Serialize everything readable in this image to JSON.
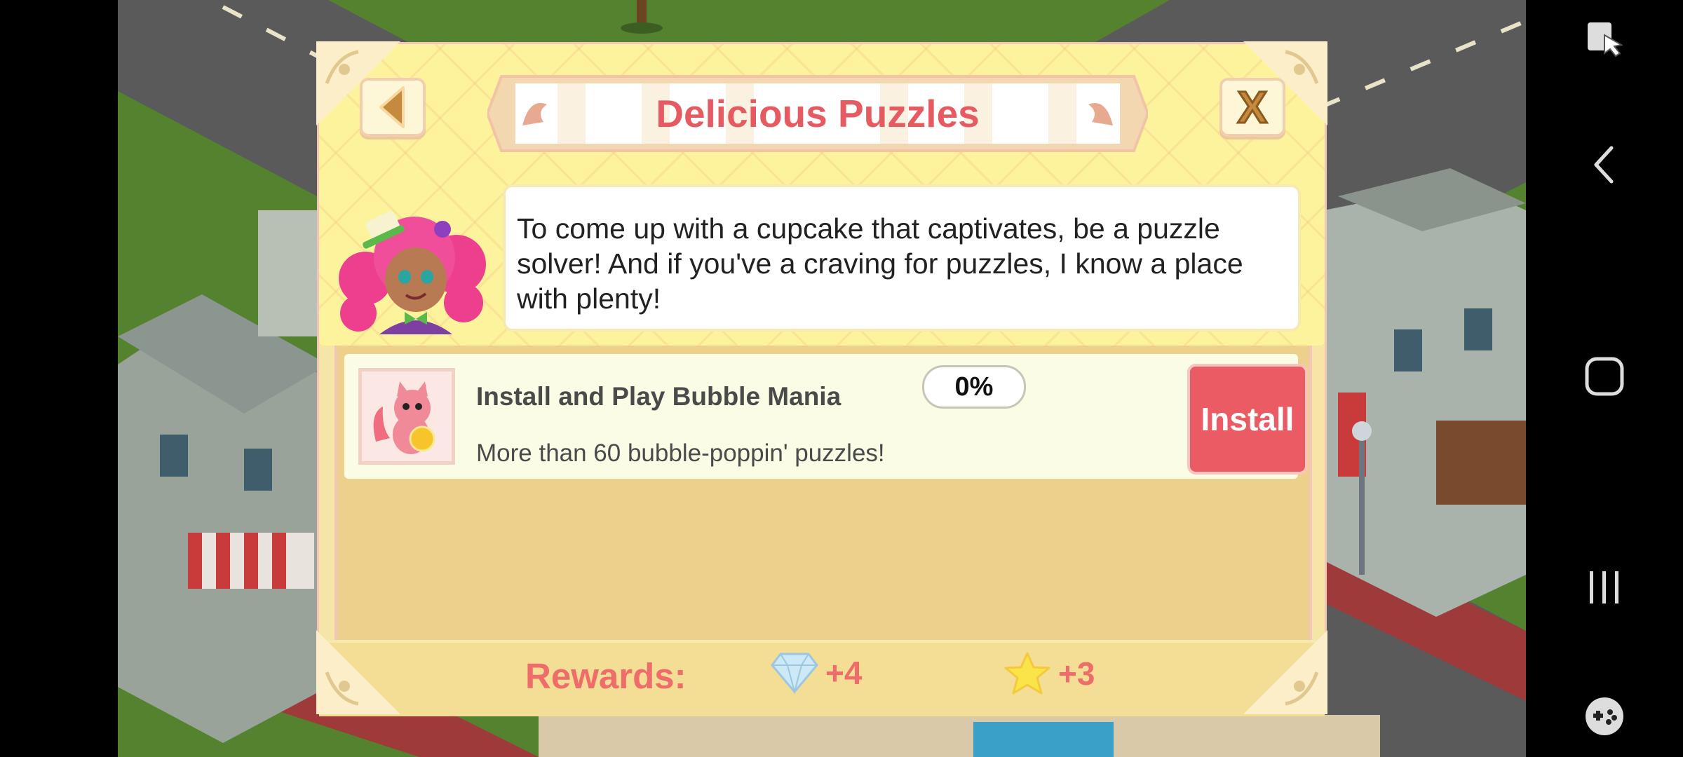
{
  "dialog": {
    "title": "Delicious Puzzles",
    "back_icon": "triangle-left-icon",
    "close_label": "X",
    "message": "To come up with a cupcake that captivates, be a puzzle solver! And if you've a craving for puzzles, I know a place with plenty!"
  },
  "offer": {
    "title": "Install and Play Bubble Mania",
    "subtitle": "More than 60 bubble-poppin' puzzles!",
    "progress": "0%",
    "install_label": "Install"
  },
  "rewards": {
    "label": "Rewards:",
    "items": [
      {
        "icon": "diamond-icon",
        "value": "+4"
      },
      {
        "icon": "star-icon",
        "value": "+3"
      }
    ]
  },
  "colors": {
    "title": "#e65a62",
    "install_button": "#ea5b64",
    "rewards_text": "#ee6d6a",
    "panel": "#fdf39d"
  },
  "system_nav": {
    "icons": [
      "screen-lock-icon",
      "back-icon",
      "home-icon",
      "recents-icon",
      "game-tools-icon"
    ]
  }
}
